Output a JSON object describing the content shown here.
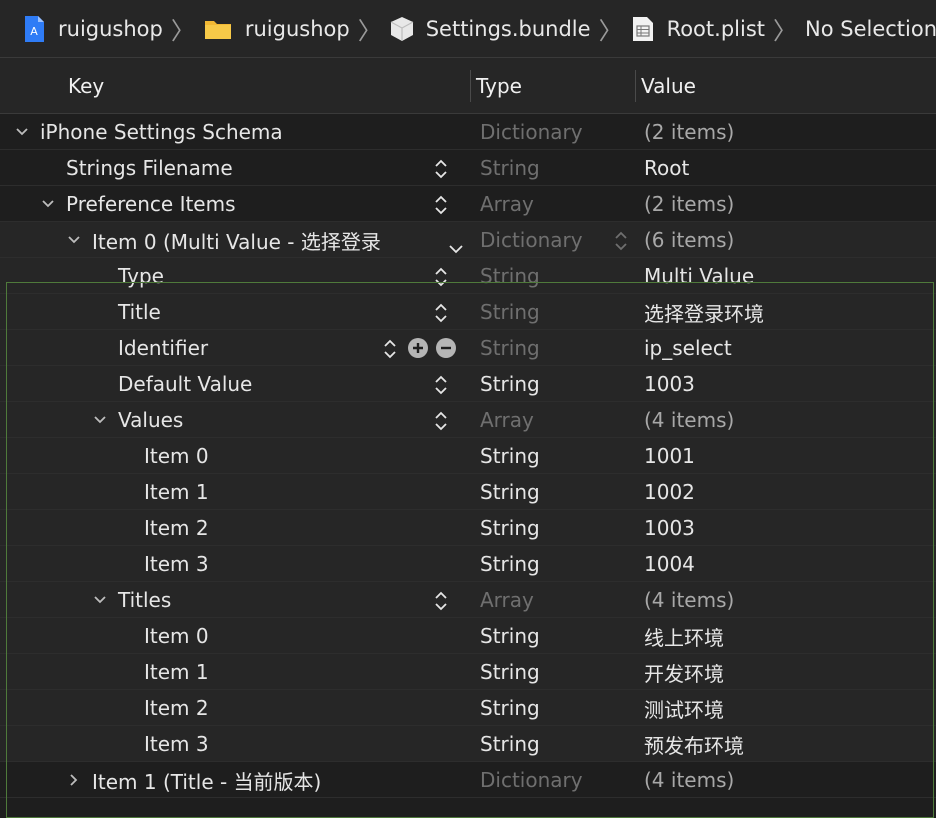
{
  "breadcrumb": [
    {
      "label": "ruigushop",
      "icon": "xcode-project-icon"
    },
    {
      "label": "ruigushop",
      "icon": "folder-icon"
    },
    {
      "label": "Settings.bundle",
      "icon": "bundle-icon"
    },
    {
      "label": "Root.plist",
      "icon": "plist-file-icon"
    },
    {
      "label": "No Selection",
      "icon": ""
    }
  ],
  "columns": {
    "key": "Key",
    "type": "Type",
    "value": "Value"
  },
  "rows": [
    {
      "key": "iPhone Settings Schema",
      "type": "Dictionary",
      "value": "(2 items)"
    },
    {
      "key": "Strings Filename",
      "type": "String",
      "value": "Root"
    },
    {
      "key": "Preference Items",
      "type": "Array",
      "value": "(2 items)"
    },
    {
      "key": "Item 0 (Multi Value - 选择登录",
      "type": "Dictionary",
      "value": "(6 items)"
    },
    {
      "key": "Type",
      "type": "String",
      "value": "Multi Value"
    },
    {
      "key": "Title",
      "type": "String",
      "value": "选择登录环境"
    },
    {
      "key": "Identifier",
      "type": "String",
      "value": "ip_select"
    },
    {
      "key": "Default Value",
      "type": "String",
      "value": "1003"
    },
    {
      "key": "Values",
      "type": "Array",
      "value": "(4 items)"
    },
    {
      "key": "Item 0",
      "type": "String",
      "value": "1001"
    },
    {
      "key": "Item 1",
      "type": "String",
      "value": "1002"
    },
    {
      "key": "Item 2",
      "type": "String",
      "value": "1003"
    },
    {
      "key": "Item 3",
      "type": "String",
      "value": "1004"
    },
    {
      "key": "Titles",
      "type": "Array",
      "value": "(4 items)"
    },
    {
      "key": "Item 0",
      "type": "String",
      "value": "线上环境"
    },
    {
      "key": "Item 1",
      "type": "String",
      "value": "开发环境"
    },
    {
      "key": "Item 2",
      "type": "String",
      "value": "测试环境"
    },
    {
      "key": "Item 3",
      "type": "String",
      "value": "预发布环境"
    },
    {
      "key": "Item 1 (Title - 当前版本)",
      "type": "Dictionary",
      "value": "(4 items)"
    }
  ],
  "colors": {
    "background": "#1e1e1e",
    "header": "#262626",
    "selection_border": "#4f7a3b",
    "dim_text": "#6f6f6f"
  }
}
